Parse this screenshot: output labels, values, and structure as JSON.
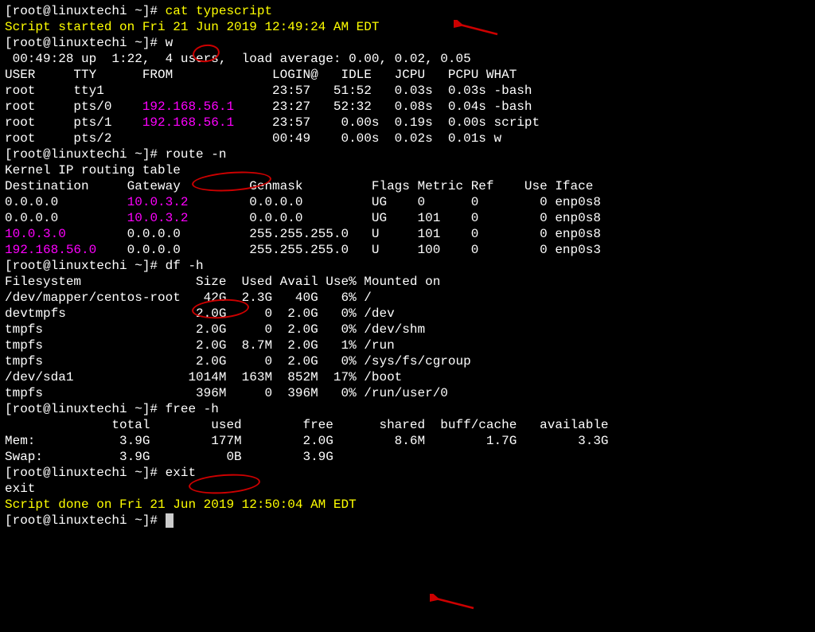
{
  "prompt": "[root@linuxtechi ~]# ",
  "cmd_cat": "cat typescript",
  "script_start": "Script started on Fri 21 Jun 2019 12:49:24 AM EDT",
  "cmd_w": "w",
  "w_header": " 00:49:28 up  1:22,  4 users,  load average: 0.00, 0.02, 0.05",
  "w_cols": "USER     TTY      FROM             LOGIN@   IDLE   JCPU   PCPU WHAT",
  "w_rows": [
    {
      "pre": "root     tty1                      23:57   51:52   0.03s  0.03s -bash"
    },
    {
      "pre": "root     pts/0    ",
      "ip": "192.168.56.1",
      "post": "     23:27   52:32   0.08s  0.04s -bash"
    },
    {
      "pre": "root     pts/1    ",
      "ip": "192.168.56.1",
      "post": "     23:57    0.00s  0.19s  0.00s script"
    },
    {
      "pre": "root     pts/2                     00:49    0.00s  0.02s  0.01s w"
    }
  ],
  "cmd_route": "route -n",
  "route_title": "Kernel IP routing table",
  "route_cols": "Destination     Gateway         Genmask         Flags Metric Ref    Use Iface",
  "route_rows": [
    {
      "dest": "0.0.0.0",
      "dpad": "         ",
      "gw": "10.0.3.2",
      "gpad": "        ",
      "rest": "0.0.0.0         UG    0      0        0 enp0s8"
    },
    {
      "dest": "0.0.0.0",
      "dpad": "         ",
      "gw": "10.0.3.2",
      "gpad": "        ",
      "rest": "0.0.0.0         UG    101    0        0 enp0s8"
    },
    {
      "dest": "10.0.3.0",
      "dpad": "        ",
      "gw": "0.0.0.0",
      "gpad": "         ",
      "rest": "255.255.255.0   U     101    0        0 enp0s8"
    },
    {
      "dest": "192.168.56.0",
      "dpad": "    ",
      "gw": "0.0.0.0",
      "gpad": "         ",
      "rest": "255.255.255.0   U     100    0        0 enp0s3"
    }
  ],
  "cmd_df": "df -h",
  "df_cols": "Filesystem               Size  Used Avail Use% Mounted on",
  "df_rows": [
    "/dev/mapper/centos-root   42G  2.3G   40G   6% /",
    "devtmpfs                 2.0G     0  2.0G   0% /dev",
    "tmpfs                    2.0G     0  2.0G   0% /dev/shm",
    "tmpfs                    2.0G  8.7M  2.0G   1% /run",
    "tmpfs                    2.0G     0  2.0G   0% /sys/fs/cgroup",
    "/dev/sda1               1014M  163M  852M  17% /boot",
    "tmpfs                    396M     0  396M   0% /run/user/0"
  ],
  "cmd_free": "free -h",
  "free_cols": "              total        used        free      shared  buff/cache   available",
  "free_rows": [
    "Mem:           3.9G        177M        2.0G        8.6M        1.7G        3.3G",
    "Swap:          3.9G          0B        3.9G"
  ],
  "cmd_exit": "exit",
  "exit_echo": "exit",
  "blank": "",
  "script_done": "Script done on Fri 21 Jun 2019 12:50:04 AM EDT"
}
